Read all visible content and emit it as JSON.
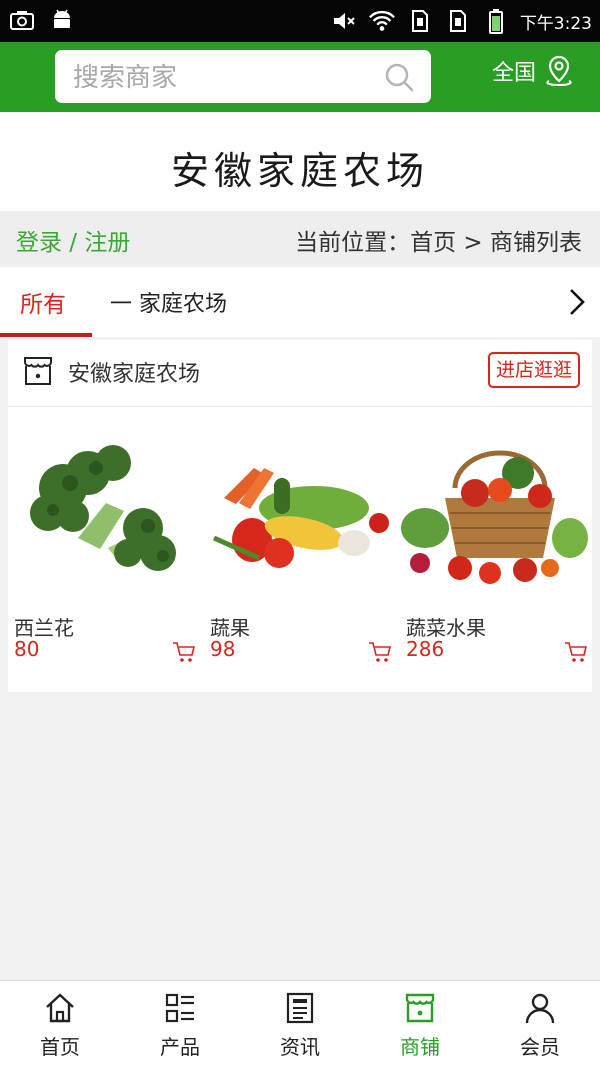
{
  "status_bar": {
    "time": "下午3:23"
  },
  "header": {
    "search_placeholder": "搜索商家",
    "region_label": "全国"
  },
  "store_title": "安徽家庭农场",
  "breadcrumb": {
    "login_register": "登录 / 注册",
    "location": "当前位置：首页 > 商铺列表"
  },
  "tabs": {
    "all": "所有",
    "category": "一 家庭农场"
  },
  "store_card": {
    "name": "安徽家庭农场",
    "visit_button": "进店逛逛",
    "products": [
      {
        "name": "西兰花",
        "price": "80"
      },
      {
        "name": "蔬果",
        "price": "98"
      },
      {
        "name": "蔬菜水果",
        "price": "286"
      }
    ]
  },
  "bottom_nav": [
    {
      "label": "首页",
      "icon": "home-icon"
    },
    {
      "label": "产品",
      "icon": "grid-list-icon"
    },
    {
      "label": "资讯",
      "icon": "news-icon"
    },
    {
      "label": "商铺",
      "icon": "shop-icon",
      "active": true
    },
    {
      "label": "会员",
      "icon": "user-icon"
    }
  ],
  "colors": {
    "brand_green": "#2a9d25",
    "accent_red": "#d9251b"
  }
}
